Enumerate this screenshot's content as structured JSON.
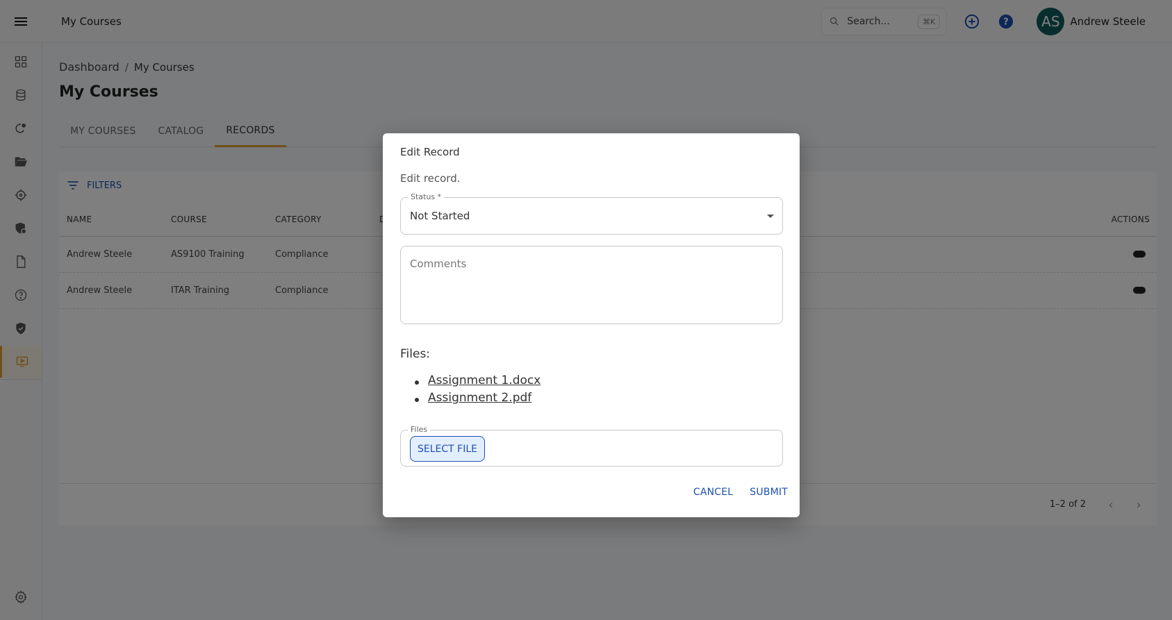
{
  "topbar": {
    "menu_icon": "hamburger-menu-icon",
    "title": "My Courses",
    "search": {
      "placeholder": "Search...",
      "shortcut": "⌘K",
      "icon": "search-icon"
    },
    "add_icon": "plus-circle-icon",
    "help_icon": "help-circle-icon",
    "user": {
      "initials": "AS",
      "name": "Andrew Steele"
    }
  },
  "sidebar": {
    "items": [
      {
        "icon": "grid-icon",
        "active": false
      },
      {
        "icon": "database-icon",
        "active": false
      },
      {
        "icon": "refresh-icon",
        "active": false
      },
      {
        "icon": "folder-open-icon",
        "active": false
      },
      {
        "icon": "crosshair-icon",
        "active": false
      },
      {
        "icon": "shield-lock-icon",
        "active": false
      },
      {
        "icon": "document-icon",
        "active": false
      },
      {
        "icon": "help-circle-icon",
        "active": false
      },
      {
        "icon": "shield-check-icon",
        "active": false
      },
      {
        "icon": "video-course-icon",
        "active": true
      }
    ],
    "settings_icon": "gear-icon"
  },
  "breadcrumb": {
    "root": "Dashboard",
    "separator": "/",
    "current": "My Courses"
  },
  "page_title": "My Courses",
  "tabs": [
    {
      "label": "MY COURSES",
      "active": false
    },
    {
      "label": "CATALOG",
      "active": false
    },
    {
      "label": "RECORDS",
      "active": true
    }
  ],
  "table": {
    "filters_label": "FILTERS",
    "columns": [
      "NAME",
      "COURSE",
      "CATEGORY",
      "D",
      "ACTIONS"
    ],
    "rows": [
      {
        "name": "Andrew Steele",
        "course": "AS9100 Training",
        "category": "Compliance"
      },
      {
        "name": "Andrew Steele",
        "course": "ITAR Training",
        "category": "Compliance"
      }
    ],
    "pagination": {
      "text": "1–2 of 2",
      "prev": "‹",
      "next": "›"
    }
  },
  "modal": {
    "title": "Edit Record",
    "description": "Edit record.",
    "status": {
      "label": "Status *",
      "value": "Not Started"
    },
    "comments": {
      "placeholder": "Comments",
      "value": ""
    },
    "files_heading": "Files:",
    "files": [
      "Assignment 1.docx",
      "Assignment 2.pdf"
    ],
    "upload": {
      "label": "Files",
      "button": "SELECT FILE"
    },
    "actions": {
      "cancel": "CANCEL",
      "submit": "SUBMIT"
    }
  },
  "colors": {
    "accent": "#e0a030",
    "primary": "#1e4fb0",
    "avatar": "#0f5d5a"
  }
}
